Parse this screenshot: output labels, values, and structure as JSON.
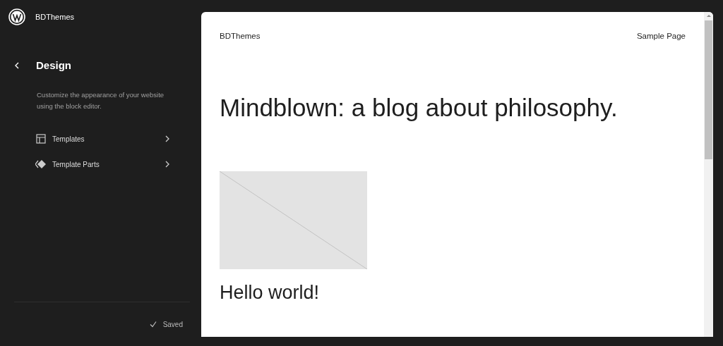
{
  "header": {
    "site_name": "BDThemes"
  },
  "sidebar": {
    "title": "Design",
    "description": "Customize the appearance of your website using the block editor.",
    "items": [
      {
        "kind": "templates",
        "label": "Templates"
      },
      {
        "kind": "template-parts",
        "label": "Template Parts"
      }
    ],
    "status": "Saved"
  },
  "preview": {
    "site_title": "BDThemes",
    "nav": [
      "Sample Page"
    ],
    "heading": "Mindblown: a blog about philosophy.",
    "post_title": "Hello world!"
  }
}
